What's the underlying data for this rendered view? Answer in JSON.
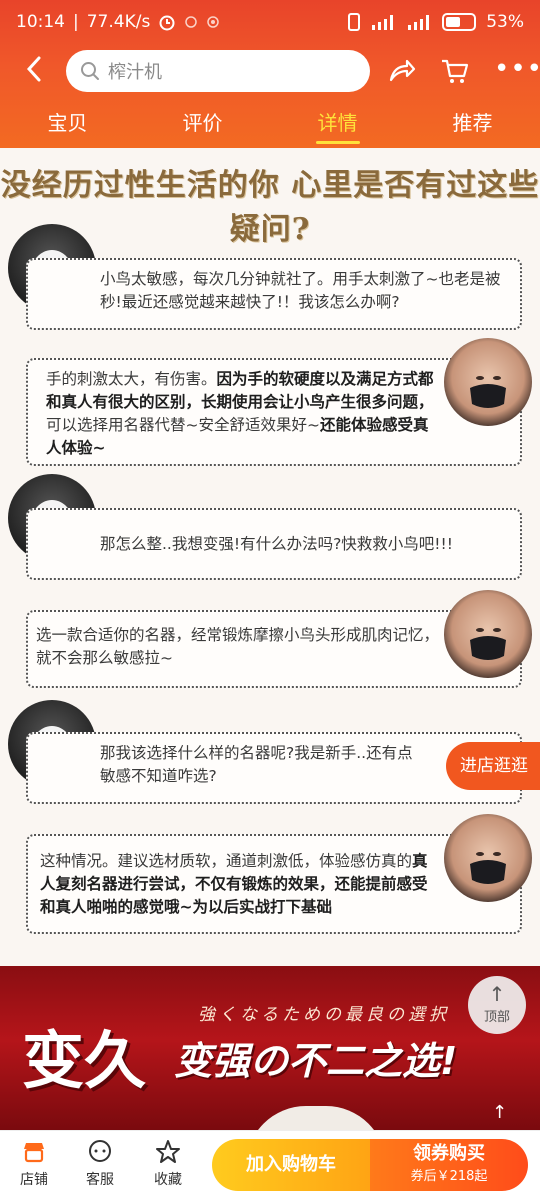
{
  "status_bar": {
    "time": "10:14",
    "net_speed": "77.4K/s",
    "battery": "53%"
  },
  "search": {
    "placeholder": "榨汁机"
  },
  "tabs": [
    "宝贝",
    "评价",
    "详情",
    "推荐"
  ],
  "content": {
    "headline": "没经历过性生活的你 心里是否有过这些疑问?",
    "messages": [
      {
        "speaker": "bird",
        "text": "小鸟太敏感，每次几分钟就社了。用手太刺激了~也老是被秒!最近还感觉越来越快了!！我该怎么办啊?"
      },
      {
        "speaker": "girl",
        "plain1": "手的刺激太大，有伤害。",
        "bold1": "因为手的软硬度以及满足方式都和真人有很大的区别，长期使用会让小鸟产生很多问题，",
        "plain2": "可以选择用名器代替~安全舒适效果好~",
        "bold2": "还能体验感受真人体验~"
      },
      {
        "speaker": "bird",
        "text": "那怎么整..我想变强!有什么办法吗?快救救小鸟吧!!!"
      },
      {
        "speaker": "girl",
        "text": "选一款合适你的名器，经常锻炼摩擦小鸟头形成肌肉记忆，就不会那么敏感拉~"
      },
      {
        "speaker": "bird",
        "text": "那我该选择什么样的名器呢?我是新手..还有点敏感不知道咋选?"
      },
      {
        "speaker": "girl",
        "plain1": "这种情况。建议选材质软，通道刺激低，体验感仿真的",
        "bold1": "真人复刻名器进行尝试，不仅有锻炼的效果，还能提前感受和真人啪啪的感觉哦~为以后实战打下基础"
      }
    ]
  },
  "floating": {
    "shop_button": "进店逛逛",
    "top_button": "顶部"
  },
  "promo": {
    "subtitle": "強くなるための最良の選択",
    "big_text": "变久",
    "tagline": "变强の不二之选!"
  },
  "bottom_bar": {
    "shop": "店铺",
    "service": "客服",
    "favorite": "收藏",
    "add_cart": "加入购物车",
    "buy_label": "领券购买",
    "buy_price": "券后￥218起"
  },
  "colors": {
    "brand_orange": "#f1571f",
    "tab_active": "#ffe13a",
    "promo_red": "#b5151a"
  }
}
